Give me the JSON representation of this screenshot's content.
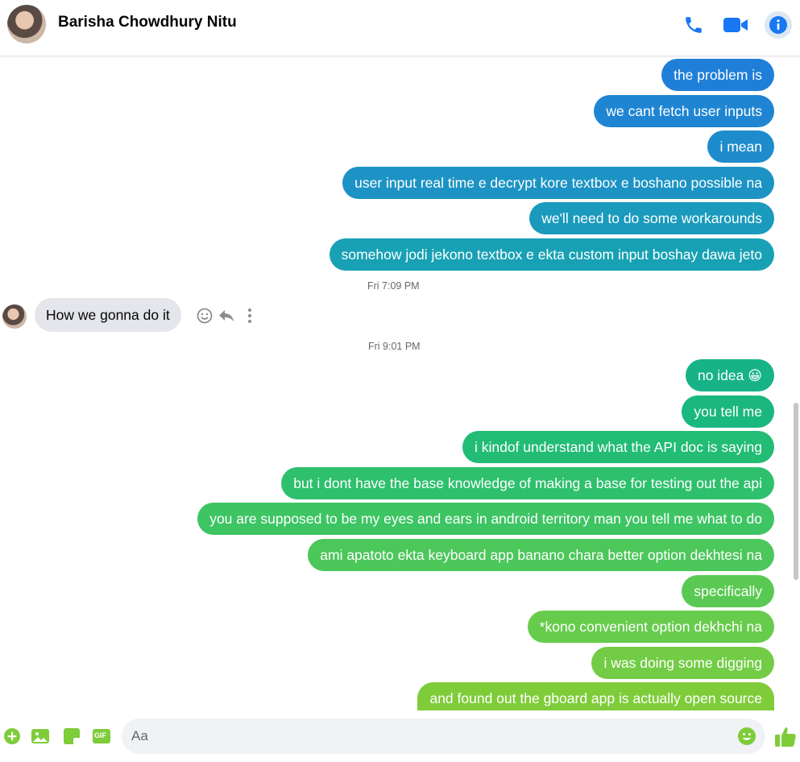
{
  "header": {
    "contact_name": "Barisha Chowdhury Nitu",
    "icons": [
      "phone-icon",
      "video-camera-icon",
      "info-icon"
    ]
  },
  "colors": {
    "accent_blue": "#1877f2",
    "accent_green": "#7fcc3a"
  },
  "messages_block_1": [
    {
      "text": "the problem is",
      "color": "#1f7fd8"
    },
    {
      "text": "we cant fetch user inputs",
      "color": "#1f85d2"
    },
    {
      "text": "i mean",
      "color": "#1e8ccc"
    },
    {
      "text": "user input real time e decrypt kore textbox e boshano possible na",
      "color": "#1c93c4"
    },
    {
      "text": "we'll need to do some workarounds",
      "color": "#1a9abd"
    },
    {
      "text": "somehow jodi jekono textbox e ekta custom input boshay dawa jeto",
      "color": "#18a1b4"
    }
  ],
  "timestamp_1": "Fri 7:09 PM",
  "incoming_message": "How we gonna do it",
  "timestamp_2": "Fri 9:01 PM",
  "messages_block_2": [
    {
      "text": "no idea",
      "emoji": "😀",
      "color": "#17b386"
    },
    {
      "text": "you tell me",
      "color": "#1ab77e"
    },
    {
      "text": "i kindof understand what the API doc is saying",
      "color": "#22bc75"
    },
    {
      "text": "but i dont have the base knowledge of making a base for testing out the api",
      "color": "#2ec06c"
    },
    {
      "text": "you are supposed to be my eyes and ears in android territory man you tell me what to do",
      "color": "#3dc463"
    },
    {
      "text": "ami apatoto ekta keyboard app banano chara better option dekhtesi na",
      "color": "#4cc75a"
    },
    {
      "text": "specifically",
      "color": "#5ac953"
    },
    {
      "text": "*kono convenient option dekhchi na",
      "color": "#67cb4c"
    },
    {
      "text": "i was doing some digging",
      "color": "#72cc45"
    },
    {
      "text": "and found out the gboard app is actually open source",
      "color": "#7fcc3a"
    }
  ],
  "composer": {
    "placeholder": "Aa",
    "icons": [
      "add-icon",
      "image-icon",
      "sticker-icon",
      "gif-icon",
      "emoji-icon",
      "like-icon"
    ],
    "gif_label": "GIF"
  }
}
